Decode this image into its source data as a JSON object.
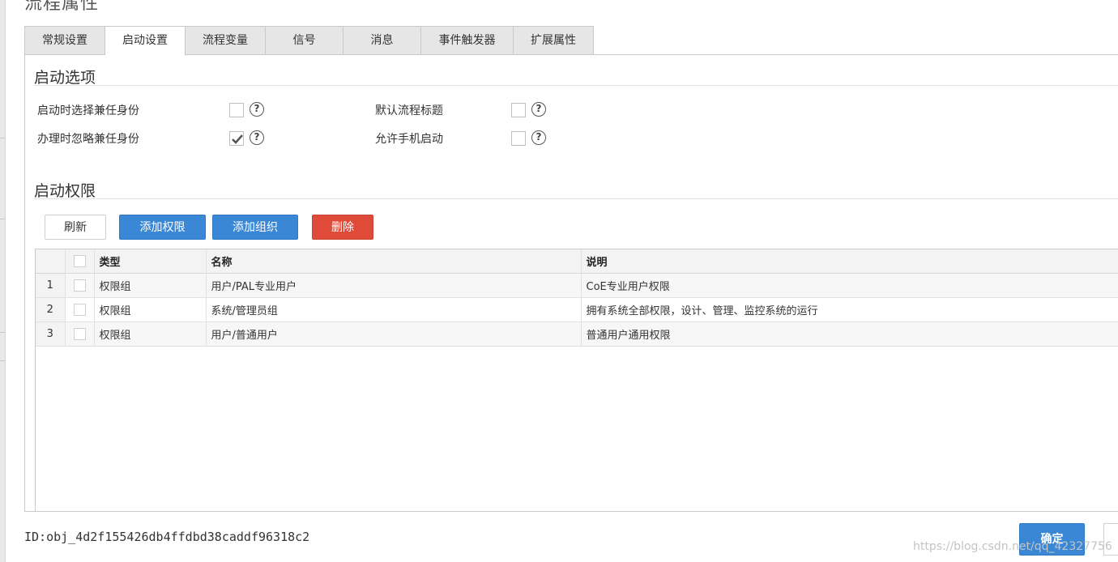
{
  "dialog_title": "流程属性",
  "tabs": [
    {
      "label": "常规设置"
    },
    {
      "label": "启动设置"
    },
    {
      "label": "流程变量"
    },
    {
      "label": "信号"
    },
    {
      "label": "消息"
    },
    {
      "label": "事件触发器"
    },
    {
      "label": "扩展属性"
    }
  ],
  "active_tab": "启动设置",
  "start_options": {
    "title": "启动选项",
    "items": [
      {
        "label": "启动时选择兼任身份",
        "checked": false
      },
      {
        "label": "办理时忽略兼任身份",
        "checked": true
      },
      {
        "label": "默认流程标题",
        "checked": false
      },
      {
        "label": "允许手机启动",
        "checked": false
      }
    ],
    "help_glyph": "?"
  },
  "start_permissions": {
    "title": "启动权限",
    "toolbar": {
      "refresh": "刷新",
      "add_permission": "添加权限",
      "add_org": "添加组织",
      "delete": "删除"
    },
    "columns": [
      "类型",
      "名称",
      "说明"
    ],
    "rows": [
      {
        "index": "1",
        "type": "权限组",
        "name": "用户/PAL专业用户",
        "desc": "CoE专业用户权限"
      },
      {
        "index": "2",
        "type": "权限组",
        "name": "系统/管理员组",
        "desc": "拥有系统全部权限，设计、管理、监控系统的运行"
      },
      {
        "index": "3",
        "type": "权限组",
        "name": "用户/普通用户",
        "desc": "普通用户通用权限"
      }
    ]
  },
  "footer": {
    "id_text": "ID:obj_4d2f155426db4ffdbd38caddf96318c2",
    "ok": "确定"
  },
  "watermark": "https://blog.csdn.net/qq_42327756",
  "colors": {
    "primary": "#3a87d6",
    "danger": "#e04b39"
  }
}
